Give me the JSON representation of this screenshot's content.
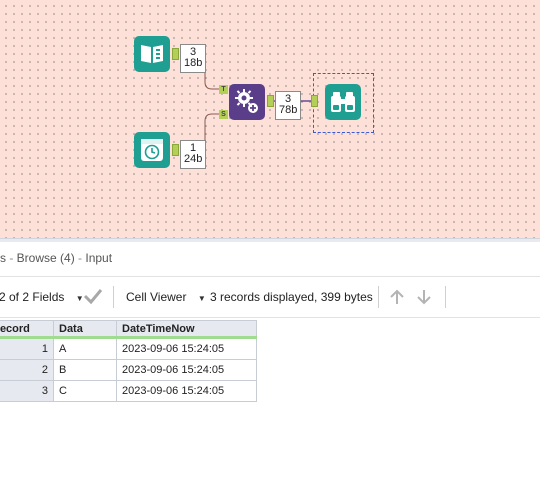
{
  "workflow": {
    "input_tool": {
      "icon": "book-icon",
      "badge": {
        "records": "3",
        "size": "18b"
      }
    },
    "datetime_tool": {
      "icon": "clock-icon",
      "badge": {
        "records": "1",
        "size": "24b"
      }
    },
    "append_tool": {
      "icon": "gears-icon",
      "anchor_t": "T",
      "anchor_s": "S",
      "badge": {
        "records": "3",
        "size": "78b"
      }
    },
    "browse_tool": {
      "icon": "binoculars-icon"
    },
    "colors": {
      "canvas": "#fde1d9",
      "teal": "#1f9e92",
      "purple": "#5a3e8a",
      "anchor": "#b4cf58",
      "selection": "#3b5bd6"
    }
  },
  "results": {
    "title_prefix": "s",
    "title_sep": " - ",
    "title_main": "Browse (4)",
    "title_sub": "Input",
    "fields_label": "2 of 2 Fields",
    "viewer_label": "Cell Viewer",
    "summary": "3 records displayed, 399 bytes",
    "columns": [
      "Record",
      "Data",
      "DateTimeNow"
    ],
    "rows": [
      {
        "record": "1",
        "data": "A",
        "datetime": "2023-09-06 15:24:05"
      },
      {
        "record": "2",
        "data": "B",
        "datetime": "2023-09-06 15:24:05"
      },
      {
        "record": "3",
        "data": "C",
        "datetime": "2023-09-06 15:24:05"
      }
    ]
  }
}
